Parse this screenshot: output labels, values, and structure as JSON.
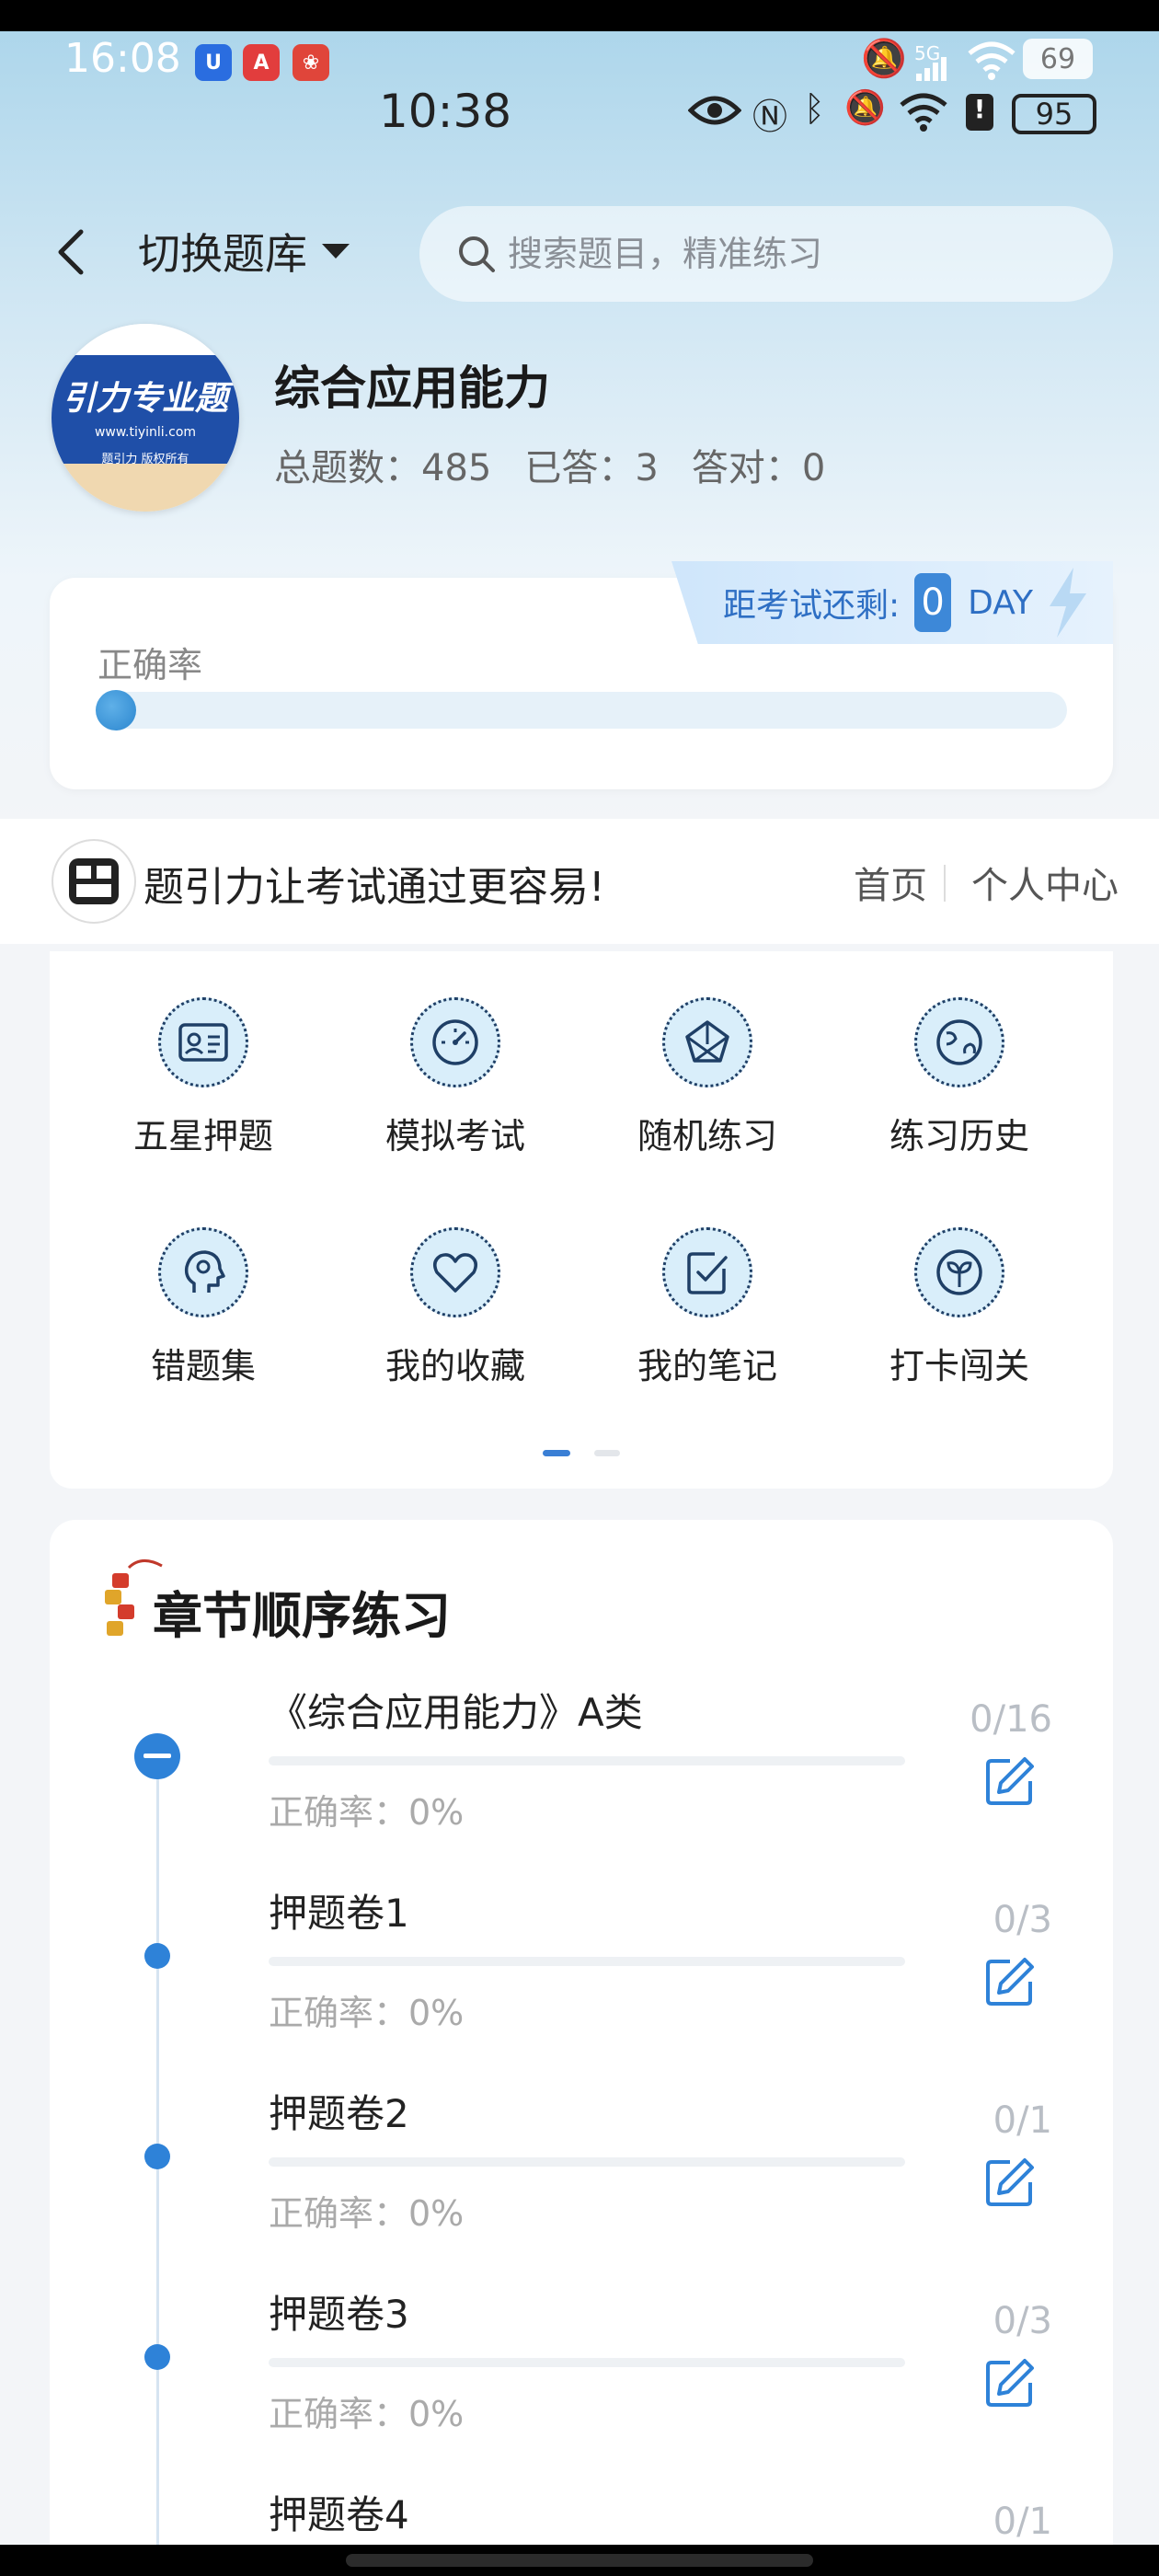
{
  "status": {
    "outer_time": "16:08",
    "outer_battery": "69",
    "inner_time": "10:38",
    "inner_battery": "95",
    "network": "5G"
  },
  "header": {
    "switch_label": "切换题库",
    "search_placeholder": "搜索题目，精准练习"
  },
  "bank": {
    "title": "综合应用能力",
    "logo_text": "引力专业题",
    "logo_url_text": "www.tiyinli.com",
    "logo_footer": "题引力 版权所有",
    "stats": [
      {
        "label": "总题数：",
        "value": "485"
      },
      {
        "label": "已答：",
        "value": "3"
      },
      {
        "label": "答对：",
        "value": "0"
      }
    ]
  },
  "countdown": {
    "label": "距考试还剩:",
    "value": "0",
    "unit": "DAY"
  },
  "accuracy": {
    "label": "正确率",
    "value_fraction": 0
  },
  "slogan": {
    "text": "题引力让考试通过更容易!",
    "nav_home": "首页",
    "nav_me": "个人中心"
  },
  "grid": [
    {
      "label": "五星押题",
      "icon": "id-card-icon"
    },
    {
      "label": "模拟考试",
      "icon": "speedometer-icon"
    },
    {
      "label": "随机练习",
      "icon": "shuffle-icon"
    },
    {
      "label": "练习历史",
      "icon": "globe-icon"
    },
    {
      "label": "错题集",
      "icon": "head-icon"
    },
    {
      "label": "我的收藏",
      "icon": "heart-icon"
    },
    {
      "label": "我的笔记",
      "icon": "check-note-icon"
    },
    {
      "label": "打卡闯关",
      "icon": "sprout-icon"
    }
  ],
  "chapters": {
    "title": "章节顺序练习",
    "items": [
      {
        "name": "《综合应用能力》A类",
        "accuracy": "正确率：0%",
        "count": "0/16"
      },
      {
        "name": "押题卷1",
        "accuracy": "正确率：0%",
        "count": "0/3"
      },
      {
        "name": "押题卷2",
        "accuracy": "正确率：0%",
        "count": "0/1"
      },
      {
        "name": "押题卷3",
        "accuracy": "正确率：0%",
        "count": "0/3"
      },
      {
        "name": "押题卷4",
        "accuracy": "",
        "count": "0/1"
      }
    ]
  },
  "colors": {
    "accent": "#2e82d8",
    "icon_fill": "#d9eefa"
  }
}
